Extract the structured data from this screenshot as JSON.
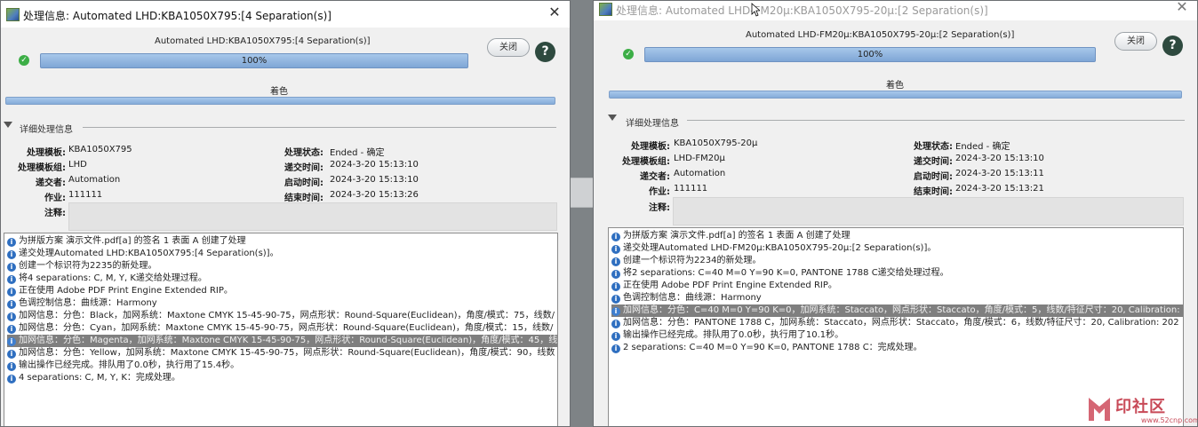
{
  "left": {
    "title": "处理信息: Automated LHD:KBA1050X795:[4 Separation(s)]",
    "job_label": "Automated LHD:KBA1050X795:[4 Separation(s)]",
    "progress_pct": 100,
    "progress_text": "100%",
    "close_label": "关闭",
    "help_label": "?",
    "color_label": "着色",
    "section_title": "详细处理信息",
    "fields": {
      "template_label": "处理模板:",
      "template": "KBA1050X795",
      "group_label": "处理模板组:",
      "group": "LHD",
      "submitter_label": "递交者:",
      "submitter": "Automation",
      "job_label": "作业:",
      "job": "111111",
      "notes_label": "注释:",
      "status_label": "处理状态:",
      "status": "Ended - 确定",
      "submit_time_label": "递交时间:",
      "submit_time": "2024-3-20 15:13:10",
      "start_time_label": "启动时间:",
      "start_time": "2024-3-20 15:13:10",
      "end_time_label": "结束时间:",
      "end_time": "2024-3-20 15:13:26"
    },
    "log": [
      "为拼版方案 演示文件.pdf[a] 的签名 1 表面 A 创建了处理",
      "递交处理Automated LHD:KBA1050X795:[4 Separation(s)]。",
      "创建一个标识符为2235的新处理。",
      "将4 separations: C, M, Y, K递交给处理过程。",
      "正在使用 Adobe PDF Print Engine Extended RIP。",
      "色调控制信息：曲线源：Harmony",
      "加网信息：分色：Black，加网系统：Maxtone CMYK 15-45-90-75，网点形状：Round-Square(Euclidean)，角度/模式：75，线数/",
      "加网信息：分色：Cyan，加网系统：Maxtone CMYK 15-45-90-75，网点形状：Round-Square(Euclidean)，角度/模式：15，线数/",
      "加网信息：分色：Magenta，加网系统：Maxtone CMYK 15-45-90-75，网点形状：Round-Square(Euclidean)，角度/模式：45，线",
      "加网信息：分色：Yellow，加网系统：Maxtone CMYK 15-45-90-75，网点形状：Round-Square(Euclidean)，角度/模式：90，线数",
      "输出操作已经完成。排队用了0.0秒，执行用了15.4秒。",
      "4 separations: C, M, Y, K：完成处理。"
    ]
  },
  "right": {
    "title": "处理信息: Automated LHD-FM20μ:KBA1050X795-20μ:[2 Separation(s)]",
    "job_label": "Automated LHD-FM20μ:KBA1050X795-20μ:[2 Separation(s)]",
    "progress_pct": 100,
    "progress_text": "100%",
    "close_label": "关闭",
    "help_label": "?",
    "color_label": "着色",
    "section_title": "详细处理信息",
    "fields": {
      "template_label": "处理模板:",
      "template": "KBA1050X795-20μ",
      "group_label": "处理模板组:",
      "group": "LHD-FM20μ",
      "submitter_label": "递交者:",
      "submitter": "Automation",
      "job_label": "作业:",
      "job": "111111",
      "notes_label": "注释:",
      "status_label": "处理状态:",
      "status": "Ended - 确定",
      "submit_time_label": "递交时间:",
      "submit_time": "2024-3-20 15:13:10",
      "start_time_label": "启动时间:",
      "start_time": "2024-3-20 15:13:11",
      "end_time_label": "结束时间:",
      "end_time": "2024-3-20 15:13:21"
    },
    "log": [
      "为拼版方案 演示文件.pdf[a] 的签名 1 表面 A 创建了处理",
      "递交处理Automated LHD-FM20μ:KBA1050X795-20μ:[2 Separation(s)]。",
      "创建一个标识符为2234的新处理。",
      "将2 separations: C=40 M=0 Y=90 K=0, PANTONE 1788 C递交给处理过程。",
      "正在使用 Adobe PDF Print Engine Extended RIP。",
      "色调控制信息：曲线源：Harmony",
      "加网信息：分色：C=40 M=0 Y=90 K=0，加网系统：Staccato，网点形状：Staccato，角度/模式：5，线数/特征尺寸：20, Calibration: 2",
      "加网信息：分色：PANTONE 1788 C，加网系统：Staccato，网点形状：Staccato，角度/模式：6，线数/特征尺寸：20, Calibration: 202",
      "输出操作已经完成。排队用了0.0秒，执行用了10.1秒。",
      "2 separations: C=40 M=0 Y=90 K=0, PANTONE 1788 C：完成处理。"
    ]
  },
  "watermark": {
    "text": "印社区",
    "url": "www.52cnp.com"
  }
}
